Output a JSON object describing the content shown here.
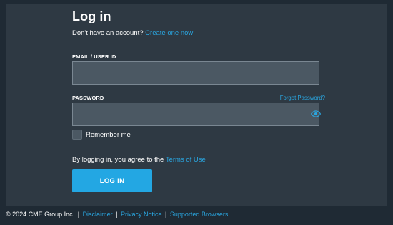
{
  "login": {
    "title": "Log in",
    "signup_prompt": "Don't have an account?",
    "signup_link": "Create one now",
    "email_label": "EMAIL / USER ID",
    "email_value": "",
    "password_label": "PASSWORD",
    "forgot_link": "Forgot Password?",
    "password_value": "",
    "eye_icon": "eye-icon",
    "remember_label": "Remember me",
    "remember_checked": false,
    "agree_text": "By logging in, you agree to the",
    "terms_link": "Terms of Use",
    "submit_label": "LOG IN"
  },
  "footer": {
    "copyright": "© 2024 CME Group Inc.",
    "separator": "|",
    "disclaimer": "Disclaimer",
    "privacy": "Privacy Notice",
    "browsers": "Supported Browsers"
  },
  "colors": {
    "background": "#1f2a34",
    "panel": "#2e3943",
    "input": "#4b5863",
    "accent": "#23a7e3",
    "link": "#2aa6e0"
  }
}
